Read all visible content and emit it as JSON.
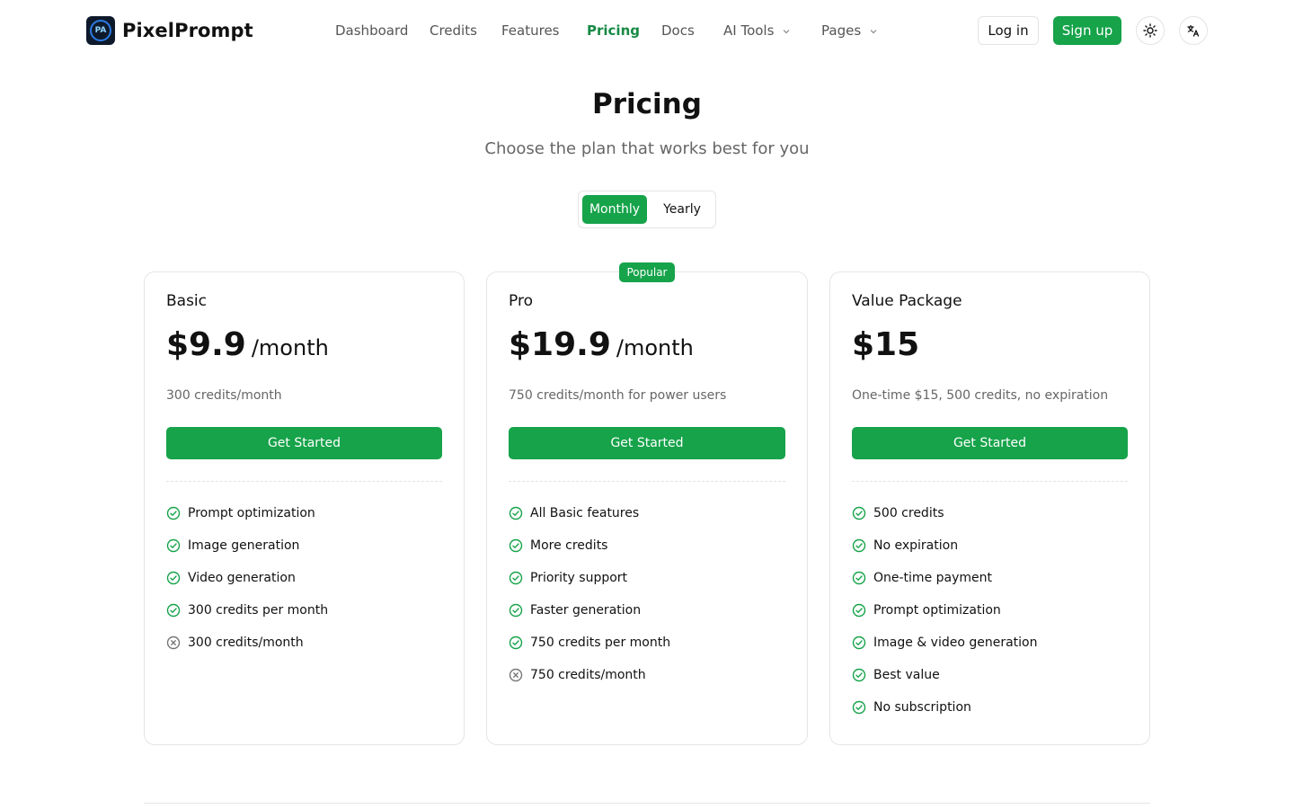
{
  "brand": {
    "name": "PixelPrompt",
    "logo_glyph": "PA"
  },
  "nav": {
    "items": [
      {
        "label": "Dashboard",
        "active": false,
        "dropdown": false
      },
      {
        "label": "Credits",
        "active": false,
        "dropdown": false
      },
      {
        "label": "Features",
        "active": false,
        "dropdown": false
      },
      {
        "label": "Pricing",
        "active": true,
        "dropdown": false
      },
      {
        "label": "Docs",
        "active": false,
        "dropdown": false
      },
      {
        "label": "AI Tools",
        "active": false,
        "dropdown": true
      },
      {
        "label": "Pages",
        "active": false,
        "dropdown": true
      }
    ]
  },
  "header": {
    "login_label": "Log in",
    "signup_label": "Sign up",
    "theme_icon": "sun-icon",
    "language_icon": "translate-icon"
  },
  "hero": {
    "title": "Pricing",
    "subtitle": "Choose the plan that works best for you"
  },
  "billing_toggle": {
    "options": [
      "Monthly",
      "Yearly"
    ],
    "selected": "Monthly"
  },
  "plans": [
    {
      "name": "Basic",
      "price": "$9.9",
      "period": "/month",
      "description": "300 credits/month",
      "cta": "Get Started",
      "badge": "",
      "features": [
        {
          "text": "Prompt optimization",
          "included": true
        },
        {
          "text": "Image generation",
          "included": true
        },
        {
          "text": "Video generation",
          "included": true
        },
        {
          "text": "300 credits per month",
          "included": true
        },
        {
          "text": "300 credits/month",
          "included": false
        }
      ]
    },
    {
      "name": "Pro",
      "price": "$19.9",
      "period": "/month",
      "description": "750 credits/month for power users",
      "cta": "Get Started",
      "badge": "Popular",
      "features": [
        {
          "text": "All Basic features",
          "included": true
        },
        {
          "text": "More credits",
          "included": true
        },
        {
          "text": "Priority support",
          "included": true
        },
        {
          "text": "Faster generation",
          "included": true
        },
        {
          "text": "750 credits per month",
          "included": true
        },
        {
          "text": "750 credits/month",
          "included": false
        }
      ]
    },
    {
      "name": "Value Package",
      "price": "$15",
      "period": "",
      "description": "One-time $15, 500 credits, no expiration",
      "cta": "Get Started",
      "badge": "",
      "features": [
        {
          "text": "500 credits",
          "included": true
        },
        {
          "text": "No expiration",
          "included": true
        },
        {
          "text": "One-time payment",
          "included": true
        },
        {
          "text": "Prompt optimization",
          "included": true
        },
        {
          "text": "Image & video generation",
          "included": true
        },
        {
          "text": "Best value",
          "included": true
        },
        {
          "text": "No subscription",
          "included": true
        }
      ]
    }
  ],
  "colors": {
    "accent": "#16a34a",
    "active_nav": "#168a44",
    "check": "#16a34a",
    "excluded": "#777777"
  }
}
